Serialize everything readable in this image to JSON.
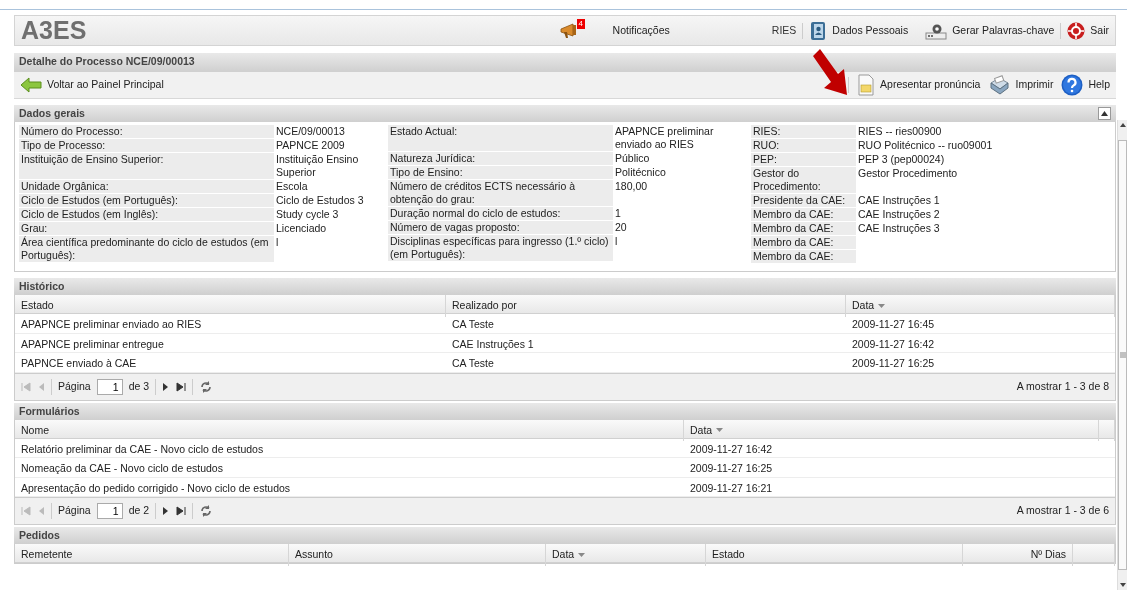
{
  "header": {
    "logo": "A3ES",
    "notifications": {
      "count": "4",
      "label": "Notificações"
    },
    "user": "RIES",
    "links": [
      {
        "kind": "personal",
        "label": "Dados Pessoais"
      },
      {
        "kind": "keys",
        "label": "Gerar Palavras-chave"
      },
      {
        "kind": "exit",
        "label": "Sair"
      }
    ]
  },
  "page_title": "Detalhe do Processo NCE/09/00013",
  "toolbar": {
    "back": "Voltar ao Painel Principal",
    "actions": [
      {
        "kind": "document",
        "label": "Apresentar pronúncia"
      },
      {
        "kind": "print",
        "label": "Imprimir"
      },
      {
        "kind": "help",
        "label": "Help"
      }
    ]
  },
  "general": {
    "title": "Dados gerais",
    "expanded": true,
    "groups": [
      [
        {
          "label": "Número do Processo:",
          "value": "NCE/09/00013"
        },
        {
          "label": "Tipo de Processo:",
          "value": "PAPNCE 2009"
        },
        {
          "label": "Instituição de Ensino Superior:",
          "value": "Instituição Ensino Superior"
        },
        {
          "label": "Unidade Orgânica:",
          "value": "Escola"
        },
        {
          "label": "Ciclo de Estudos (em Português):",
          "value": "Ciclo de Estudos 3"
        },
        {
          "label": "Ciclo de Estudos (em Inglês):",
          "value": "Study cycle 3"
        },
        {
          "label": "Grau:",
          "value": "Licenciado"
        },
        {
          "label": "Área científica predominante do ciclo de estudos (em Português):",
          "value": "l"
        }
      ],
      [
        {
          "label": "Estado Actual:",
          "value": "APAPNCE preliminar enviado ao RIES"
        },
        {
          "label": "Natureza Jurídica:",
          "value": "Público"
        },
        {
          "label": "Tipo de Ensino:",
          "value": "Politécnico"
        },
        {
          "label": "Número de créditos ECTS necessário à obtenção do grau:",
          "value": "180,00"
        },
        {
          "label": "Duração normal do ciclo de estudos:",
          "value": "1"
        },
        {
          "label": "Número de vagas proposto:",
          "value": "20"
        },
        {
          "label": "Disciplinas específicas para ingresso (1.º ciclo) (em Português):",
          "value": "l"
        }
      ],
      [
        {
          "label": "RIES:",
          "value": "RIES -- ries00900"
        },
        {
          "label": "RUO:",
          "value": "RUO Politécnico -- ruo09001"
        },
        {
          "label": "PEP:",
          "value": "PEP 3 (pep00024)"
        },
        {
          "label": "Gestor do Procedimento:",
          "value": "Gestor Procedimento"
        },
        {
          "label": "Presidente da CAE:",
          "value": "CAE Instruções 1"
        },
        {
          "label": "Membro da CAE:",
          "value": "CAE Instruções 2"
        },
        {
          "label": "Membro da CAE:",
          "value": "CAE Instruções 3"
        },
        {
          "label": "Membro da CAE:"
        },
        {
          "label": "Membro da CAE:"
        }
      ]
    ]
  },
  "history": {
    "title": "Histórico",
    "columns": [
      {
        "label": "Estado",
        "sorted": false
      },
      {
        "label": "Realizado por",
        "sorted": false
      },
      {
        "label": "Data",
        "sorted": true
      }
    ],
    "rows": [
      [
        "APAPNCE preliminar enviado ao RIES",
        "CA Teste",
        "2009-11-27 16:45"
      ],
      [
        "APAPNCE preliminar entregue",
        "CAE Instruções 1",
        "2009-11-27 16:42"
      ],
      [
        "PAPNCE enviado à CAE",
        "CA Teste",
        "2009-11-27 16:25"
      ]
    ],
    "pager": {
      "page_label": "Página",
      "page": "1",
      "of": "de 3",
      "summary": "A mostrar 1 - 3 de 8"
    }
  },
  "forms": {
    "title": "Formulários",
    "columns": [
      {
        "label": "Nome",
        "sorted": false
      },
      {
        "label": "Data",
        "sorted": true
      }
    ],
    "rows": [
      [
        "Relatório preliminar da CAE - Novo ciclo de estudos",
        "2009-11-27 16:42"
      ],
      [
        "Nomeação da CAE - Novo ciclo de estudos",
        "2009-11-27 16:25"
      ],
      [
        "Apresentação do pedido corrigido - Novo ciclo de estudos",
        "2009-11-27 16:21"
      ]
    ],
    "pager": {
      "page_label": "Página",
      "page": "1",
      "of": "de 2",
      "summary": "A mostrar 1 - 3 de 6"
    }
  },
  "requests": {
    "title": "Pedidos",
    "columns": [
      {
        "label": "Remetente",
        "sorted": false
      },
      {
        "label": "Assunto",
        "sorted": false
      },
      {
        "label": "Data",
        "sorted": true
      },
      {
        "label": "Estado",
        "sorted": false
      },
      {
        "label": "Nº Dias",
        "sorted": false
      }
    ]
  }
}
